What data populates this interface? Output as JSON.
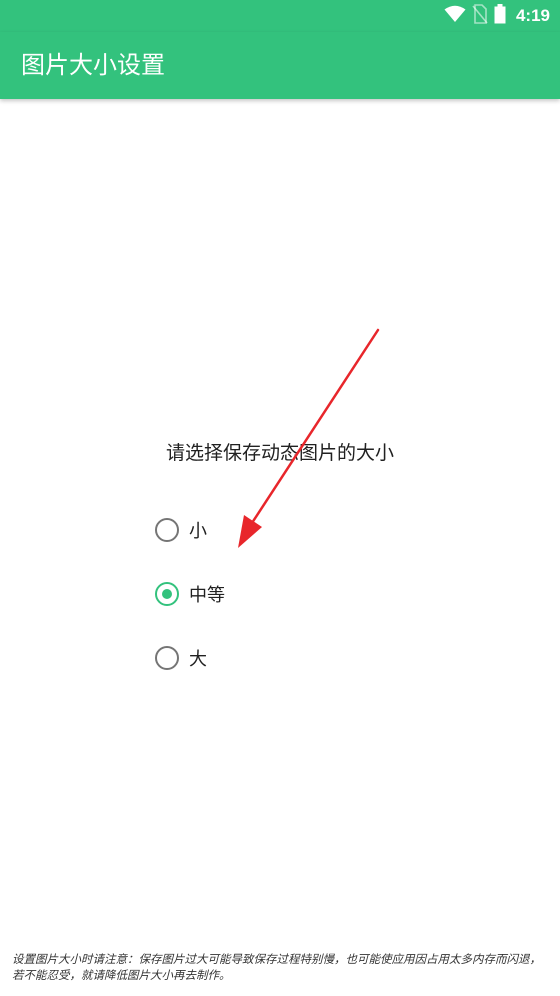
{
  "status_bar": {
    "time": "4:19",
    "icons": [
      "wifi-icon",
      "no-sim-icon",
      "battery-icon"
    ]
  },
  "app_bar": {
    "title": "图片大小设置"
  },
  "main": {
    "prompt": "请选择保存动态图片的大小",
    "options": [
      {
        "label": "小",
        "checked": false
      },
      {
        "label": "中等",
        "checked": true
      },
      {
        "label": "大",
        "checked": false
      }
    ]
  },
  "footer": {
    "note": "设置图片大小时请注意：保存图片过大可能导致保存过程特别慢，也可能使应用因占用太多内存而闪退，若不能忍受，就请降低图片大小再去制作。"
  },
  "colors": {
    "accent": "#33c27d",
    "annotation_arrow": "#e8262b"
  }
}
